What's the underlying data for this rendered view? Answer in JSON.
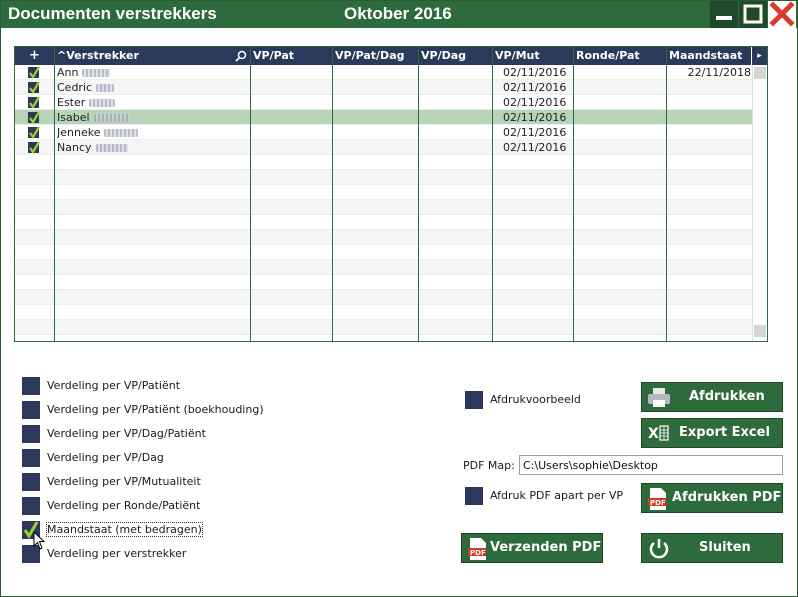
{
  "window": {
    "title": "Documenten verstrekkers",
    "period": "Oktober 2016"
  },
  "grid": {
    "columns": [
      "+",
      "^Verstrekker",
      "VP/Pat",
      "VP/Pat/Dag",
      "VP/Dag",
      "VP/Mut",
      "Ronde/Pat",
      "Maandstaat"
    ],
    "rows": [
      {
        "name": "Ann",
        "vp_mut": "02/11/2016",
        "maandstaat": "22/11/2018",
        "checked": true
      },
      {
        "name": "Cedric",
        "vp_mut": "02/11/2016",
        "maandstaat": "",
        "checked": true
      },
      {
        "name": "Ester",
        "vp_mut": "02/11/2016",
        "maandstaat": "",
        "checked": true
      },
      {
        "name": "Isabel",
        "vp_mut": "02/11/2016",
        "maandstaat": "",
        "checked": true,
        "selected": true
      },
      {
        "name": "Jenneke",
        "vp_mut": "02/11/2016",
        "maandstaat": "",
        "checked": true
      },
      {
        "name": "Nancy",
        "vp_mut": "02/11/2016",
        "maandstaat": "",
        "checked": true
      }
    ]
  },
  "options": [
    {
      "label": "Verdeling per VP/Patiënt",
      "checked": false
    },
    {
      "label": "Verdeling per VP/Patiënt (boekhouding)",
      "checked": false
    },
    {
      "label": "Verdeling per VP/Dag/Patiënt",
      "checked": false
    },
    {
      "label": "Verdeling per VP/Dag",
      "checked": false
    },
    {
      "label": "Verdeling per VP/Mutualiteit",
      "checked": false
    },
    {
      "label": "Verdeling per Ronde/Patiënt",
      "checked": false
    },
    {
      "label": "Maandstaat (met bedragen)",
      "checked": true
    },
    {
      "label": "Verdeling per verstrekker",
      "checked": false
    }
  ],
  "print_preview": {
    "label": "Afdrukvoorbeeld",
    "checked": false
  },
  "pdf_separate": {
    "label": "Afdruk PDF apart per VP",
    "checked": false
  },
  "pdf_map": {
    "label": "PDF Map:",
    "value": "C:\\Users\\sophie\\Desktop"
  },
  "buttons": {
    "print": "Afdrukken",
    "export_excel": "Export Excel",
    "print_pdf": "Afdrukken PDF",
    "send_pdf": "Verzenden PDF",
    "close": "Sluiten"
  },
  "colors": {
    "accent": "#2e6b3c",
    "header": "#2b3a5a",
    "selected_row": "#b7d4b9"
  }
}
